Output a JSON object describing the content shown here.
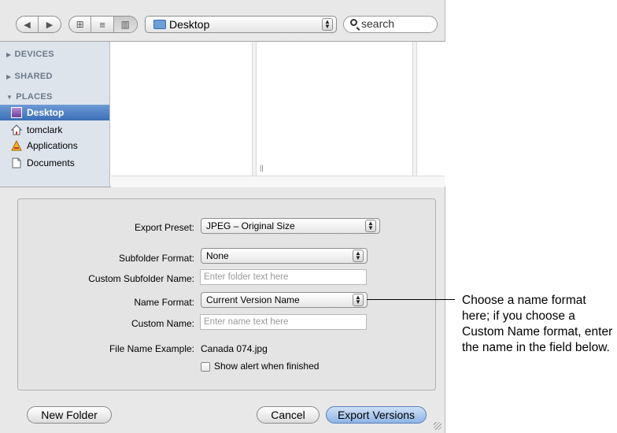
{
  "toolbar": {
    "back_icon": "triangle-left-icon",
    "forward_icon": "triangle-right-icon",
    "view_icons": [
      "icon-view-icon",
      "list-view-icon",
      "column-view-icon"
    ],
    "location": "Desktop",
    "search_placeholder": "search"
  },
  "sidebar": {
    "devices": "DEVICES",
    "shared": "SHARED",
    "places": "PLACES",
    "items": [
      {
        "label": "Desktop",
        "icon": "desktop-icon",
        "selected": true
      },
      {
        "label": "tomclark",
        "icon": "home-icon",
        "selected": false
      },
      {
        "label": "Applications",
        "icon": "applications-icon",
        "selected": false
      },
      {
        "label": "Documents",
        "icon": "documents-icon",
        "selected": false
      }
    ]
  },
  "options": {
    "export_preset_label": "Export Preset:",
    "export_preset_value": "JPEG – Original Size",
    "subfolder_format_label": "Subfolder Format:",
    "subfolder_format_value": "None",
    "custom_subfolder_label": "Custom Subfolder Name:",
    "custom_subfolder_placeholder": "Enter folder text here",
    "name_format_label": "Name Format:",
    "name_format_value": "Current Version Name",
    "custom_name_label": "Custom Name:",
    "custom_name_placeholder": "Enter name text here",
    "file_name_example_label": "File Name Example:",
    "file_name_example_value": "Canada 074.jpg",
    "show_alert_label": "Show alert when finished",
    "show_alert_checked": false
  },
  "buttons": {
    "new_folder": "New Folder",
    "cancel": "Cancel",
    "export_versions": "Export Versions"
  },
  "callout": {
    "text": "Choose a name format here; if you choose a Custom Name format, enter the name in the field below."
  },
  "colors": {
    "selection": "#3c6eb6",
    "sidebar_bg": "#dde4ec",
    "dialog_bg": "#e8e8e8"
  }
}
